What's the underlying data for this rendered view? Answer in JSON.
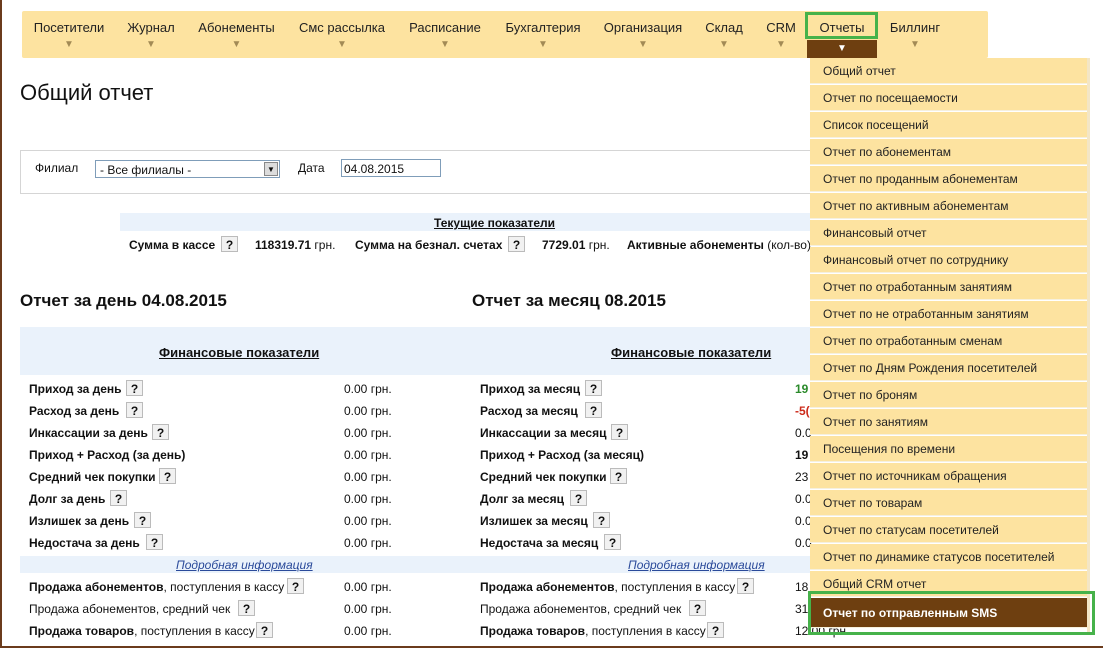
{
  "nav": {
    "items": [
      "Посетители",
      "Журнал",
      "Абонементы",
      "Смс рассылка",
      "Расписание",
      "Бухгалтерия",
      "Организация",
      "Склад",
      "CRM",
      "Отчеты",
      "Биллинг"
    ],
    "arrow": "▼"
  },
  "page": {
    "title": "Общий отчет"
  },
  "filter": {
    "branch_label": "Филиал",
    "branch_value": "- Все филиалы -",
    "date_label": "Дата",
    "date_value": "04.08.2015"
  },
  "current": {
    "heading": "Текущие показатели",
    "cash_label": "Сумма в кассе",
    "cash_value": "118319.71",
    "currency": "грн.",
    "noncash_label": "Сумма на безнал. счетах",
    "noncash_value": "7729.01",
    "active_label": "Активные абонементы",
    "active_suffix": "(кол-во)"
  },
  "day": {
    "title": "Отчет за день 04.08.2015",
    "fin_heading": "Финансовые показатели",
    "rows": [
      {
        "label": "Приход за день",
        "value": "0.00 грн."
      },
      {
        "label": "Расход за день",
        "value": "0.00 грн."
      },
      {
        "label": "Инкассации за день",
        "value": "0.00 грн."
      },
      {
        "label": "Приход + Расход (за день)",
        "value": "0.00 грн."
      },
      {
        "label": "Средний чек покупки",
        "value": "0.00 грн."
      },
      {
        "label": "Долг за день",
        "value": "0.00 грн."
      },
      {
        "label": "Излишек за день",
        "value": "0.00 грн."
      },
      {
        "label": "Недостача за день",
        "value": "0.00 грн."
      }
    ],
    "detail": "Подробная информация",
    "detail_rows": [
      {
        "label": "Продажа абонементов",
        "suffix": ", поступления в кассу",
        "value": "0.00 грн."
      },
      {
        "label": "Продажа абонементов, средний чек",
        "suffix": "",
        "value": "0.00 грн."
      },
      {
        "label": "Продажа товаров",
        "suffix": ", поступления в кассу",
        "value": "0.00 грн."
      }
    ]
  },
  "month": {
    "title": "Отчет за месяц 08.2015",
    "fin_heading": "Финансовые показатели",
    "rows": [
      {
        "label": "Приход за месяц",
        "value": "19"
      },
      {
        "label": "Расход за месяц",
        "value": "-5("
      },
      {
        "label": "Инкассации за месяц",
        "value": "0.0"
      },
      {
        "label": "Приход + Расход (за месяц)",
        "value": "19"
      },
      {
        "label": "Средний чек покупки",
        "value": "23"
      },
      {
        "label": "Долг за месяц",
        "value": "0.0"
      },
      {
        "label": "Излишек за месяц",
        "value": "0.0"
      },
      {
        "label": "Недостача за месяц",
        "value": "0.0"
      }
    ],
    "detail": "Подробная информация",
    "detail_rows": [
      {
        "label": "Продажа абонементов",
        "suffix": ", поступления в кассу",
        "value": "18"
      },
      {
        "label": "Продажа абонементов, средний чек",
        "suffix": "",
        "value": "31"
      },
      {
        "label": "Продажа товаров",
        "suffix": ", поступления в кассу",
        "value": "12.00 грн."
      }
    ]
  },
  "help": "?",
  "reports_menu": [
    "Общий отчет",
    "Отчет по посещаемости",
    "Список посещений",
    "Отчет по абонементам",
    "Отчет по проданным абонементам",
    "Отчет по активным абонементам",
    "Финансовый отчет",
    "Финансовый отчет по сотруднику",
    "Отчет по отработанным занятиям",
    "Отчет по не отработанным занятиям",
    "Отчет по отработанным сменам",
    "Отчет по Дням Рождения посетителей",
    "Отчет по броням",
    "Отчет по занятиям",
    "Посещения по времени",
    "Отчет по источникам обращения",
    "Отчет по товарам",
    "Отчет по статусам посетителей",
    "Отчет по динамике статусов посетителей",
    "Общий CRM отчет",
    "Отчет по отправленным SMS"
  ],
  "colors": {
    "nav_bg": "#fde3a0",
    "active_bg": "#6e3f10",
    "highlight": "#46b24a",
    "income": "#2a8a2a",
    "expense": "#cc2a1a"
  }
}
